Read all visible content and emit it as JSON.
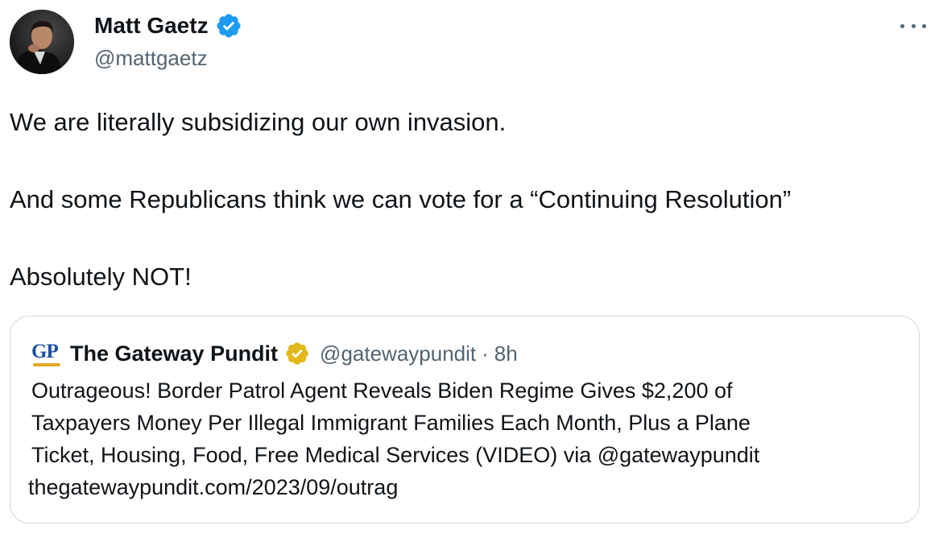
{
  "author": {
    "name": "Matt Gaetz",
    "handle": "@mattgaetz",
    "verified_badge": "blue-check-badge"
  },
  "more_menu": {
    "icon": "more-horizontal-icon"
  },
  "tweet": {
    "lines": [
      "We are literally subsidizing our own invasion.",
      "And some Republicans think we can vote for a “Continuing Resolution”",
      "Absolutely NOT!"
    ]
  },
  "quoted_tweet": {
    "logo_text": "GP",
    "name": "The Gateway Pundit",
    "verified_badge": "gold-check-badge",
    "handle": "@gatewaypundit",
    "separator": "·",
    "time": "8h",
    "body_lines": [
      "Outrageous! Border Patrol Agent Reveals Biden Regime Gives $2,200 of",
      "Taxpayers Money Per Illegal Immigrant Families Each Month, Plus a Plane",
      "Ticket, Housing, Food, Free Medical Services (VIDEO) via @gatewaypundit"
    ],
    "link": "thegatewaypundit.com/2023/09/outrag"
  },
  "colors": {
    "text_primary": "#0f1419",
    "text_secondary": "#536471",
    "verified_blue": "#1d9bf0",
    "verified_gold": "#e2b719",
    "border": "#cfd9de",
    "gp_blue": "#1e4fa2",
    "gp_gold": "#e5a824"
  }
}
